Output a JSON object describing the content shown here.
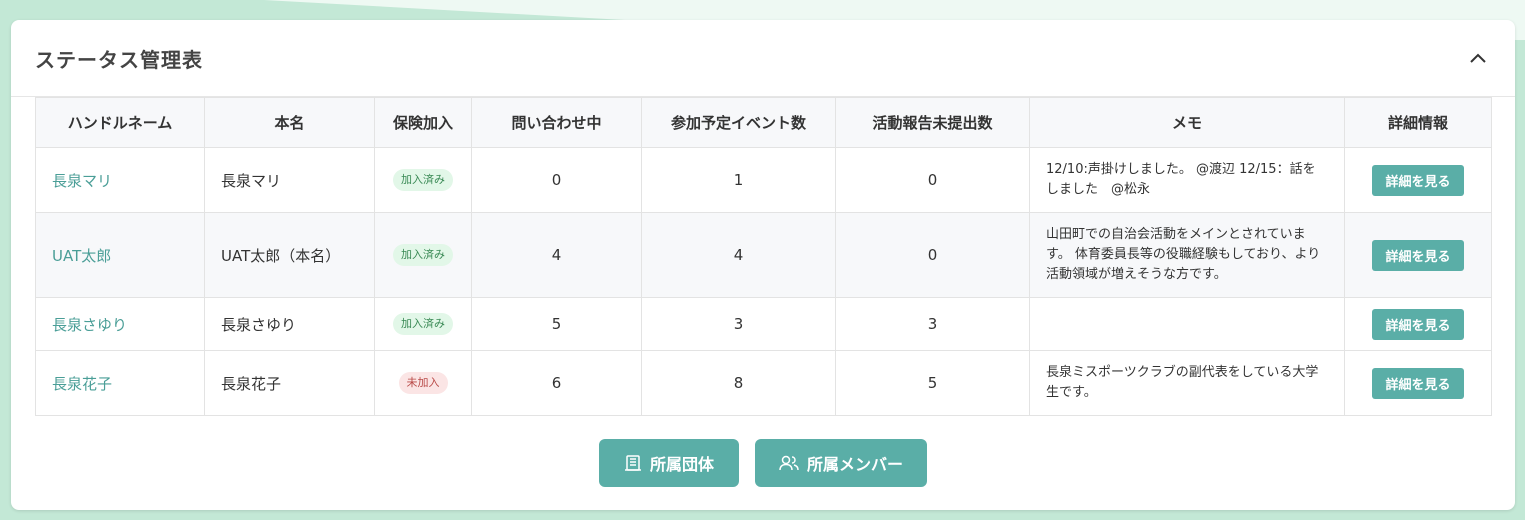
{
  "page": {
    "title": "ステータス管理表"
  },
  "table": {
    "headers": [
      "ハンドルネーム",
      "本名",
      "保険加入",
      "問い合わせ中",
      "参加予定イベント数",
      "活動報告未提出数",
      "メモ",
      "詳細情報"
    ],
    "rows": [
      {
        "handle": "長泉マリ",
        "name": "長泉マリ",
        "insurance": "加入済み",
        "insurance_status": "ok",
        "inquiries": "0",
        "events": "1",
        "reports": "0",
        "memo": "12/10:声掛けしました。 @渡辺 12/15：話をしました　@松永",
        "detail": "詳細を見る"
      },
      {
        "handle": "UAT太郎",
        "name": "UAT太郎（本名）",
        "insurance": "加入済み",
        "insurance_status": "ok",
        "inquiries": "4",
        "events": "4",
        "reports": "0",
        "memo": "山田町での自治会活動をメインとされています。 体育委員長等の役職経験もしており、より活動領域が増えそうな方です。",
        "detail": "詳細を見る"
      },
      {
        "handle": "長泉さゆり",
        "name": "長泉さゆり",
        "insurance": "加入済み",
        "insurance_status": "ok",
        "inquiries": "5",
        "events": "3",
        "reports": "3",
        "memo": "",
        "detail": "詳細を見る"
      },
      {
        "handle": "長泉花子",
        "name": "長泉花子",
        "insurance": "未加入",
        "insurance_status": "ng",
        "inquiries": "6",
        "events": "8",
        "reports": "5",
        "memo": "長泉ミスポーツクラブの副代表をしている大学生です。",
        "detail": "詳細を見る"
      }
    ]
  },
  "footer": {
    "groups_button": {
      "label": "所属団体",
      "icon": "building-icon"
    },
    "members_button": {
      "label": "所属メンバー",
      "icon": "users-icon"
    }
  },
  "colors": {
    "accent": "#5aaea7",
    "link": "#4a9e97",
    "background": "#c3e8d6"
  }
}
